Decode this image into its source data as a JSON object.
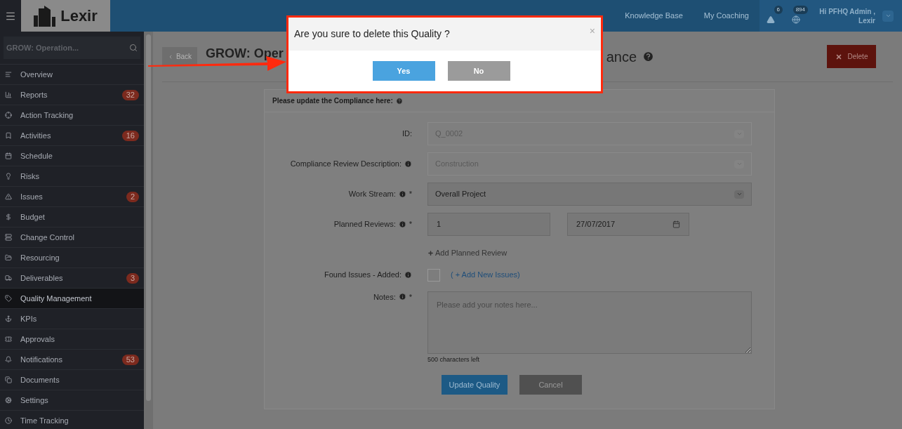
{
  "topbar": {
    "logo": "Lexir",
    "nav": [
      {
        "label": "Knowledge Base"
      },
      {
        "label": "My Coaching"
      }
    ],
    "alerts": [
      {
        "count": "6"
      },
      {
        "count": "894"
      }
    ],
    "user": {
      "greeting": "Hi PFHQ Admin ,",
      "org": "Lexir"
    }
  },
  "sidebar": {
    "search": {
      "value": "GROW: Operation..."
    },
    "items": [
      {
        "label": "Overview",
        "selected": false
      },
      {
        "label": "Reports",
        "badge": "32",
        "selected": false
      },
      {
        "label": "Action Tracking",
        "selected": false
      },
      {
        "label": "Activities",
        "badge": "16",
        "selected": false
      },
      {
        "label": "Schedule",
        "selected": false
      },
      {
        "label": "Risks",
        "selected": false
      },
      {
        "label": "Issues",
        "badge": "2",
        "selected": false
      },
      {
        "label": "Budget",
        "selected": false
      },
      {
        "label": "Change Control",
        "selected": false
      },
      {
        "label": "Resourcing",
        "selected": false
      },
      {
        "label": "Deliverables",
        "badge": "3",
        "selected": false
      },
      {
        "label": "Quality Management",
        "selected": true
      },
      {
        "label": "KPIs",
        "selected": false
      },
      {
        "label": "Approvals",
        "selected": false
      },
      {
        "label": "Notifications",
        "badge": "53",
        "selected": false
      },
      {
        "label": "Documents",
        "selected": false
      },
      {
        "label": "Settings",
        "selected": false
      },
      {
        "label": "Time Tracking",
        "selected": false
      }
    ]
  },
  "header": {
    "back": "Back",
    "title_start": "GROW: Oper",
    "title_end": "ance",
    "delete": "Delete"
  },
  "form": {
    "heading": "Please update the Compliance here:",
    "rows": [
      {
        "kind": "select",
        "label": "ID:",
        "info": false,
        "required": false,
        "value": "Q_0002",
        "disabled": true
      },
      {
        "kind": "select",
        "label": "Compliance Review Description:",
        "info": true,
        "required": false,
        "value": "Construction",
        "disabled": true
      },
      {
        "kind": "select",
        "label": "Work Stream:",
        "info": true,
        "required": true,
        "value": "Overall Project",
        "disabled": false
      },
      {
        "kind": "pair",
        "label": "Planned Reviews:",
        "info": true,
        "required": true,
        "value": "1",
        "date": "27/07/2017",
        "add": "Add Planned Review"
      },
      {
        "kind": "checkbox",
        "label": "Found Issues - Added:",
        "info": true,
        "required": false,
        "checked": false,
        "link": "( + Add New Issues)"
      },
      {
        "kind": "textarea",
        "label": "Notes:",
        "info": true,
        "required": true,
        "placeholder": "Please add your notes here...",
        "hint": "500 characters left"
      }
    ],
    "required_mark": "*",
    "submit": "Update Quality",
    "cancel": "Cancel"
  },
  "modal": {
    "title": "Are you sure to delete this Quality ?",
    "close": "×",
    "buttons": [
      {
        "label": "Yes",
        "kind": "primary"
      },
      {
        "label": "No",
        "kind": "secondary"
      }
    ]
  }
}
